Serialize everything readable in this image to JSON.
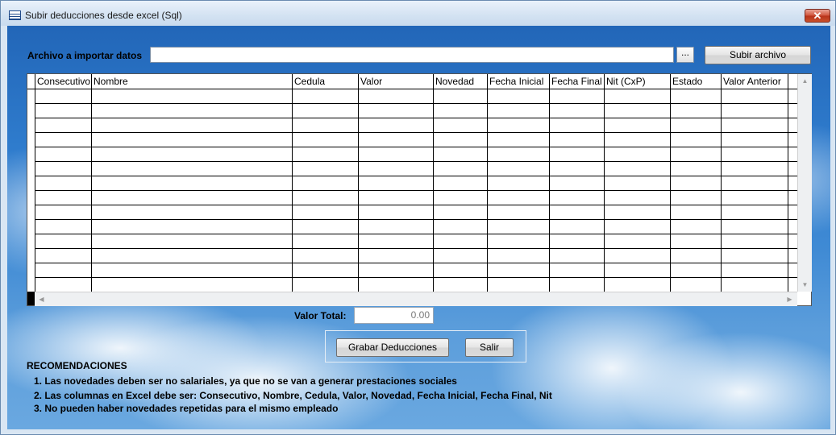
{
  "window": {
    "title": "Subir deducciones desde excel (Sql)",
    "close_glyph": "✕"
  },
  "file": {
    "label": "Archivo a importar datos",
    "value": "",
    "browse_label": "...",
    "upload_label": "Subir archivo"
  },
  "grid": {
    "columns": [
      "Consecutivo",
      "Nombre",
      "Cedula",
      "Valor",
      "Novedad",
      "Fecha Inicial",
      "Fecha Final",
      "Nit (CxP)",
      "Estado",
      "Valor Anterior"
    ],
    "rows": []
  },
  "total": {
    "label": "Valor Total:",
    "value": "0.00"
  },
  "actions": {
    "save_label": "Grabar Deducciones",
    "exit_label": "Salir"
  },
  "recommendations": {
    "heading": "RECOMENDACIONES",
    "items": [
      "1. Las novedades deben ser no salariales, ya que no se van a generar prestaciones sociales",
      "2. Las columnas en Excel debe ser: Consecutivo, Nombre, Cedula, Valor, Novedad, Fecha Inicial, Fecha Final, Nit",
      "3. No pueden haber novedades repetidas para el mismo empleado"
    ]
  },
  "colors": {
    "background_top": "#2266b8",
    "background_bottom": "#6aa8e0",
    "close_button": "#c9502c"
  }
}
